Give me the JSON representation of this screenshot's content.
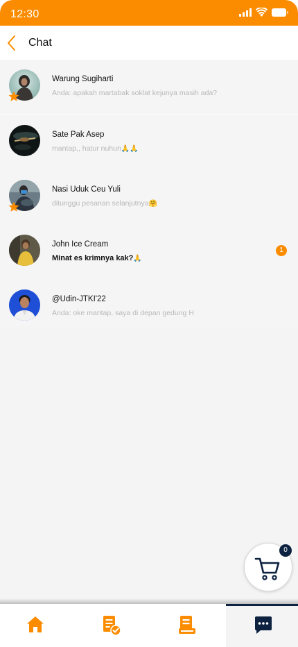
{
  "status_bar": {
    "time": "12:30",
    "icons": [
      "signal-icon",
      "wifi-icon",
      "battery-icon"
    ]
  },
  "header": {
    "title": "Chat",
    "back_icon": "chevron-left-icon"
  },
  "colors": {
    "brand_orange": "#fb8c00",
    "navy": "#0d2240",
    "list_bg": "#f5f5f5",
    "muted_text": "#b8b8b8"
  },
  "chats": [
    {
      "name": "Warung Sugiharti",
      "preview": "Anda: apakah martabak soklat kejunya masih ada?",
      "starred": true,
      "unread": false
    },
    {
      "name": "Sate Pak Asep",
      "preview": "mantap,, hatur nuhun",
      "preview_emoji": "🙏🙏",
      "starred": false,
      "unread": false
    },
    {
      "name": "Nasi Uduk Ceu Yuli",
      "preview": "ditunggu pesanan selanjutnya",
      "preview_emoji": "🤗",
      "starred": true,
      "unread": false
    },
    {
      "name": "John Ice Cream",
      "preview": "Minat es krimnya kak?",
      "preview_emoji": "🙏",
      "starred": false,
      "unread": true,
      "unread_count": "1"
    },
    {
      "name": "@Udin-JTKI'22",
      "preview": "Anda: oke mantap, saya di depan gedung H",
      "starred": false,
      "unread": false
    }
  ],
  "cart": {
    "count": "0",
    "icon": "shopping-cart-icon"
  },
  "bottom_nav": [
    {
      "name": "home",
      "icon": "home-icon",
      "active": false
    },
    {
      "name": "orders",
      "icon": "order-check-icon",
      "active": false
    },
    {
      "name": "history",
      "icon": "receipt-icon",
      "active": false
    },
    {
      "name": "chat",
      "icon": "chat-bubble-icon",
      "active": true
    }
  ]
}
